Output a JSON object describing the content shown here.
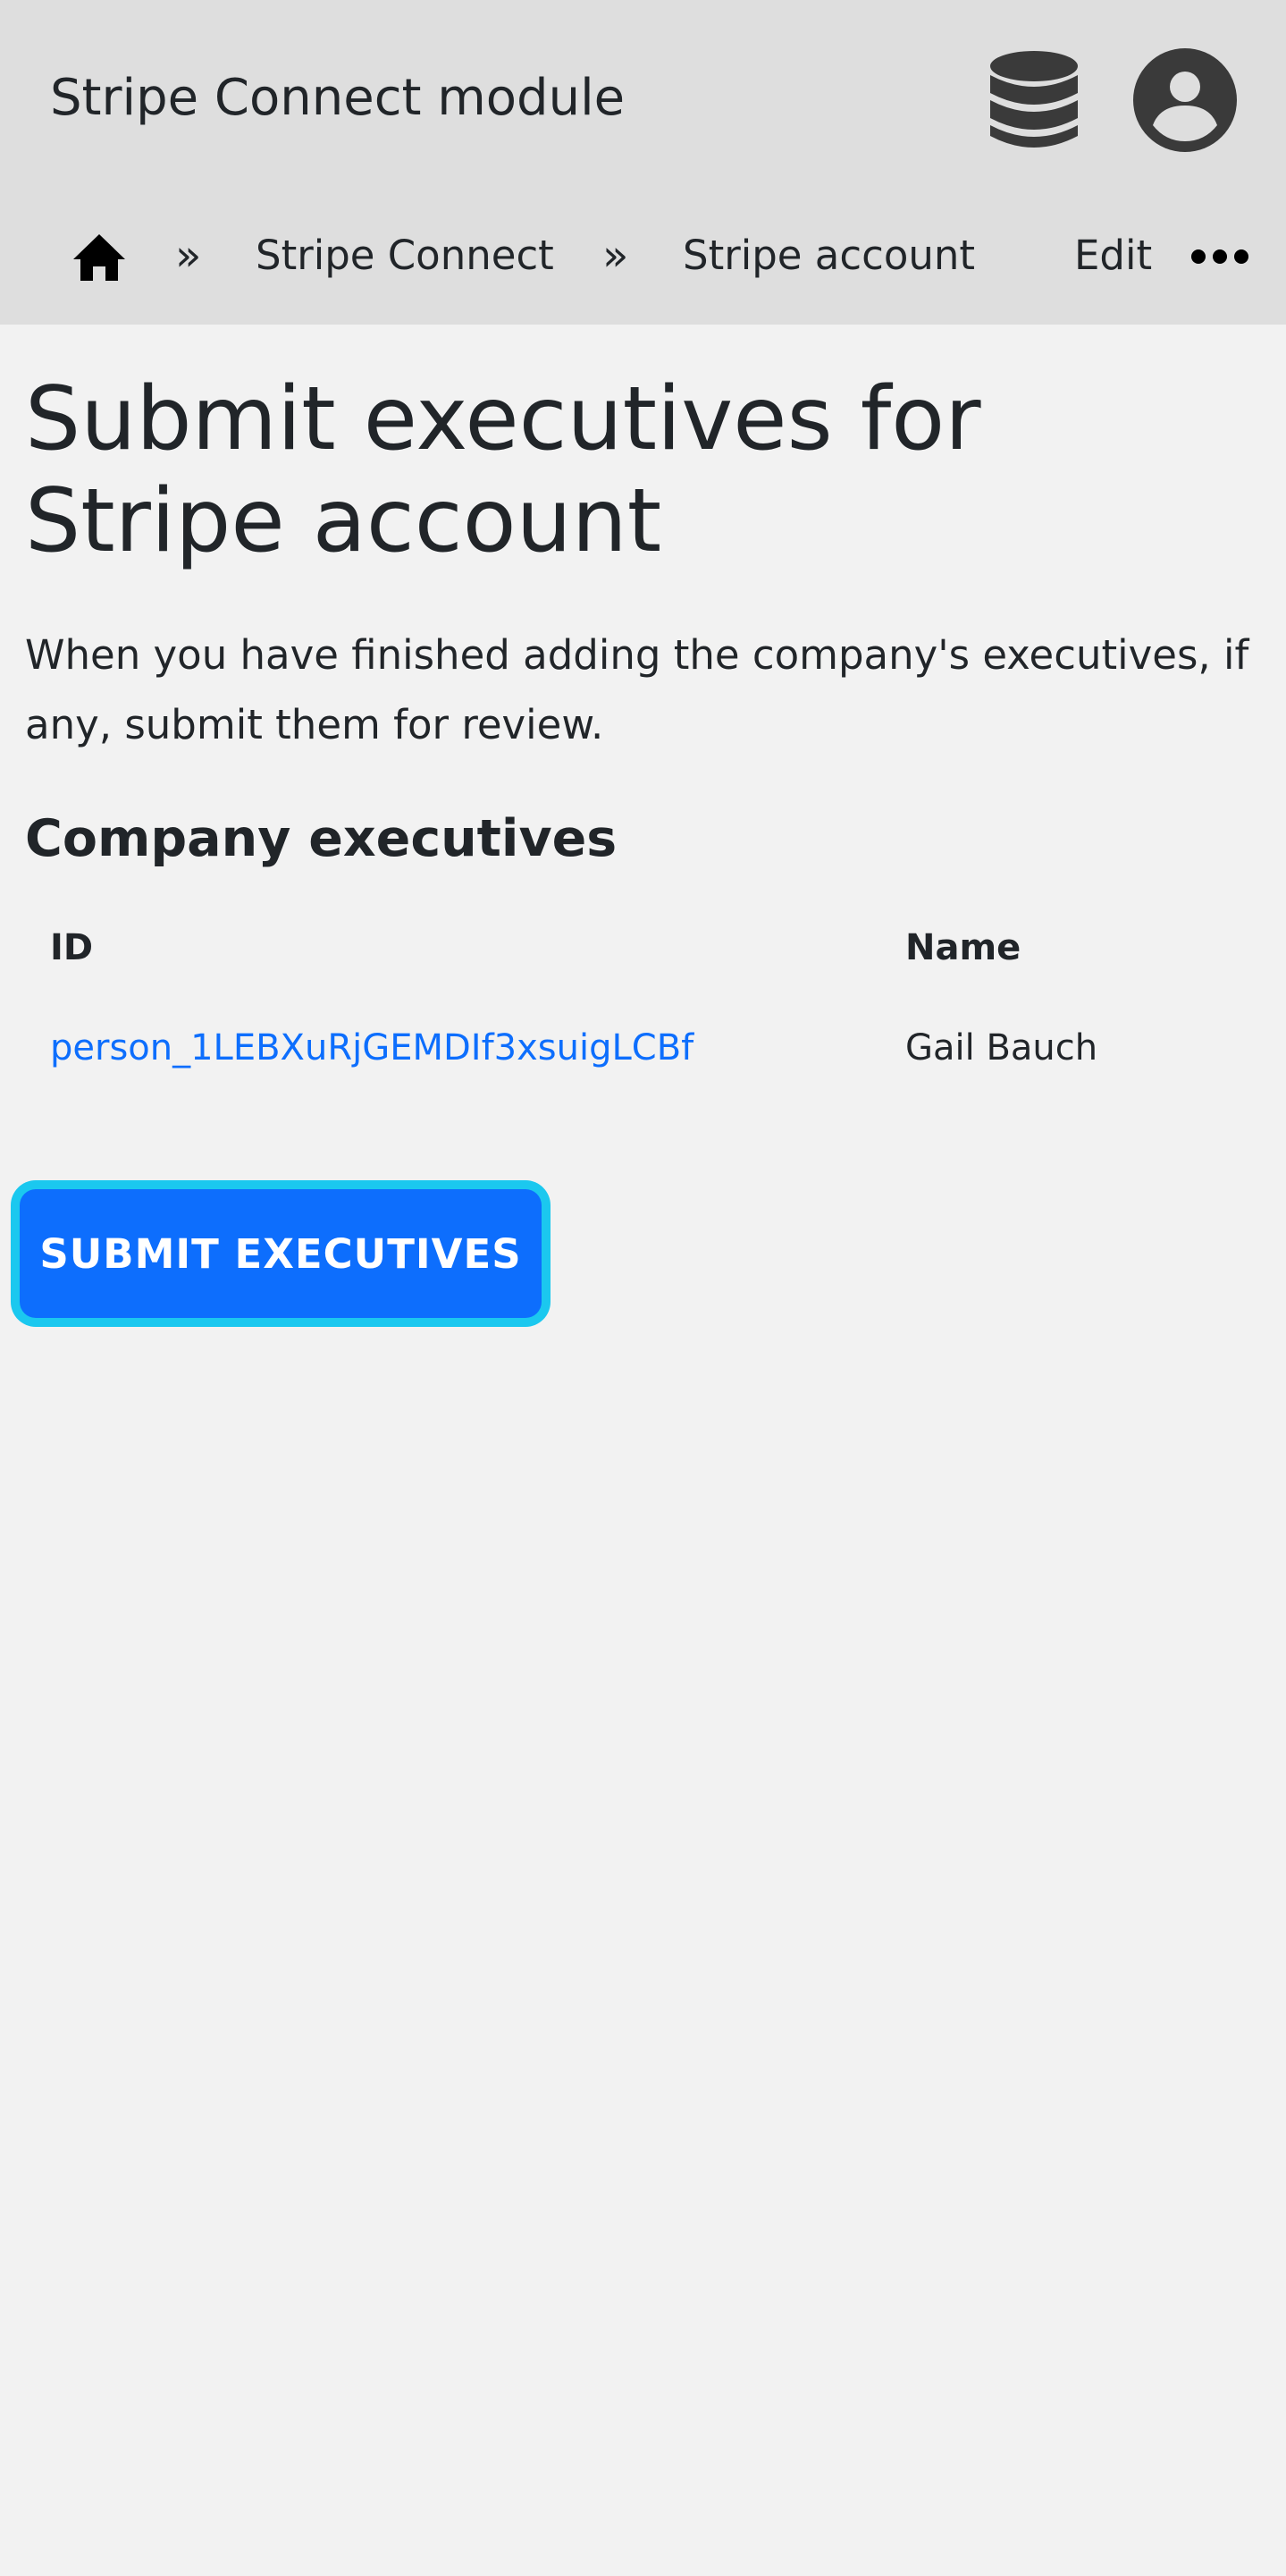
{
  "header": {
    "title": "Stripe Connect module",
    "icons": {
      "database": "database-icon",
      "user": "user-account-icon"
    }
  },
  "breadcrumb": {
    "home_icon": "home-icon",
    "separator": "»",
    "items": [
      "Stripe Connect",
      "Stripe account",
      "Edit"
    ],
    "more_icon": "more-icon"
  },
  "main": {
    "title": "Submit executives for Stripe account",
    "intro": "When you have finished adding the company's executives, if any, submit them for review.",
    "section_title": "Company executives",
    "table": {
      "headers": [
        "ID",
        "Name"
      ],
      "rows": [
        {
          "id": "person_1LEBXuRjGEMDIf3xsuigLCBf",
          "name": "Gail Bauch"
        }
      ]
    },
    "submit_label": "SUBMIT EXECUTIVES"
  },
  "colors": {
    "header_bg": "#dedede",
    "page_bg": "#f2f2f2",
    "accent": "#0d6efd",
    "focus_ring": "#1bc8ef",
    "text": "#212529"
  }
}
